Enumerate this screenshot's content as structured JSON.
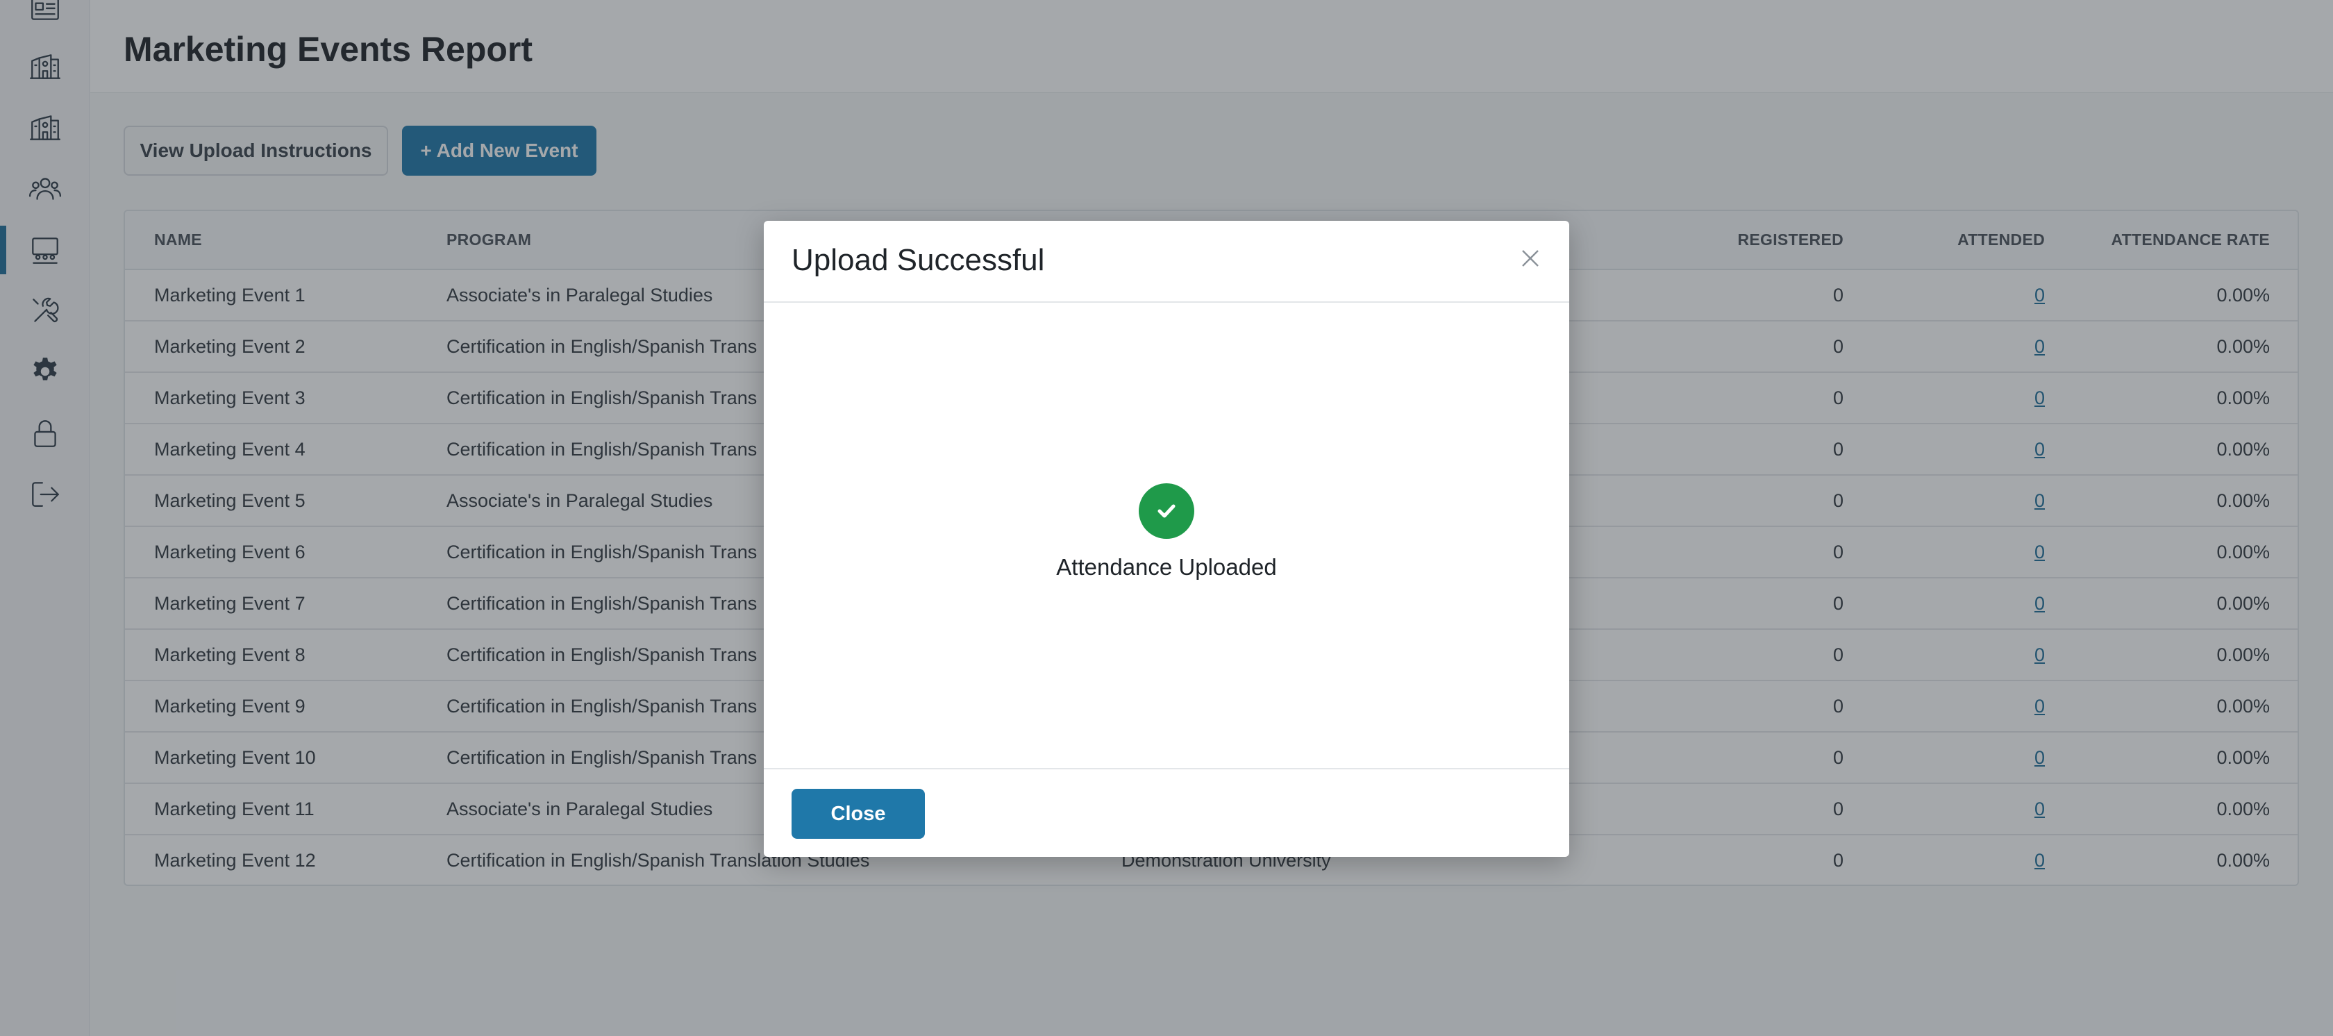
{
  "sidebar": {
    "items": [
      {
        "icon": "newspaper-icon"
      },
      {
        "icon": "building-icon"
      },
      {
        "icon": "school-icon"
      },
      {
        "icon": "users-icon"
      },
      {
        "icon": "presentation-icon",
        "active": true
      },
      {
        "icon": "tools-icon"
      },
      {
        "icon": "gear-icon"
      },
      {
        "icon": "lock-icon"
      },
      {
        "icon": "logout-icon"
      }
    ]
  },
  "header": {
    "title": "Marketing Events Report"
  },
  "toolbar": {
    "instructions_label": "View Upload Instructions",
    "add_label": "+ Add New Event"
  },
  "table": {
    "columns": {
      "name": "NAME",
      "program": "PROGRAM",
      "registered": "REGISTERED",
      "attended": "ATTENDED",
      "rate": "ATTENDANCE RATE"
    },
    "rows": [
      {
        "name": "Marketing Event 1",
        "program": "Associate's in Paralegal Studies",
        "institution": "",
        "registered": "0",
        "attended": "0",
        "rate": "0.00%"
      },
      {
        "name": "Marketing Event 2",
        "program": "Certification in English/Spanish Trans",
        "institution": "",
        "registered": "0",
        "attended": "0",
        "rate": "0.00%"
      },
      {
        "name": "Marketing Event 3",
        "program": "Certification in English/Spanish Trans",
        "institution": "",
        "registered": "0",
        "attended": "0",
        "rate": "0.00%"
      },
      {
        "name": "Marketing Event 4",
        "program": "Certification in English/Spanish Trans",
        "institution": "",
        "registered": "0",
        "attended": "0",
        "rate": "0.00%"
      },
      {
        "name": "Marketing Event 5",
        "program": "Associate's in Paralegal Studies",
        "institution": "",
        "registered": "0",
        "attended": "0",
        "rate": "0.00%"
      },
      {
        "name": "Marketing Event 6",
        "program": "Certification in English/Spanish Trans",
        "institution": "",
        "registered": "0",
        "attended": "0",
        "rate": "0.00%"
      },
      {
        "name": "Marketing Event 7",
        "program": "Certification in English/Spanish Trans",
        "institution": "",
        "registered": "0",
        "attended": "0",
        "rate": "0.00%"
      },
      {
        "name": "Marketing Event 8",
        "program": "Certification in English/Spanish Trans",
        "institution": "",
        "registered": "0",
        "attended": "0",
        "rate": "0.00%"
      },
      {
        "name": "Marketing Event 9",
        "program": "Certification in English/Spanish Trans",
        "institution": "",
        "registered": "0",
        "attended": "0",
        "rate": "0.00%"
      },
      {
        "name": "Marketing Event 10",
        "program": "Certification in English/Spanish Trans",
        "institution": "",
        "registered": "0",
        "attended": "0",
        "rate": "0.00%"
      },
      {
        "name": "Marketing Event 11",
        "program": "Associate's in Paralegal Studies",
        "institution": "",
        "registered": "0",
        "attended": "0",
        "rate": "0.00%"
      },
      {
        "name": "Marketing Event 12",
        "program": "Certification in English/Spanish Translation Studies",
        "institution": "Demonstration University",
        "registered": "0",
        "attended": "0",
        "rate": "0.00%"
      }
    ]
  },
  "modal": {
    "title": "Upload Successful",
    "message": "Attendance Uploaded",
    "close_label": "Close"
  },
  "colors": {
    "accent": "#1f78a9",
    "success": "#1f9a4a",
    "link": "#1f6f9a"
  }
}
